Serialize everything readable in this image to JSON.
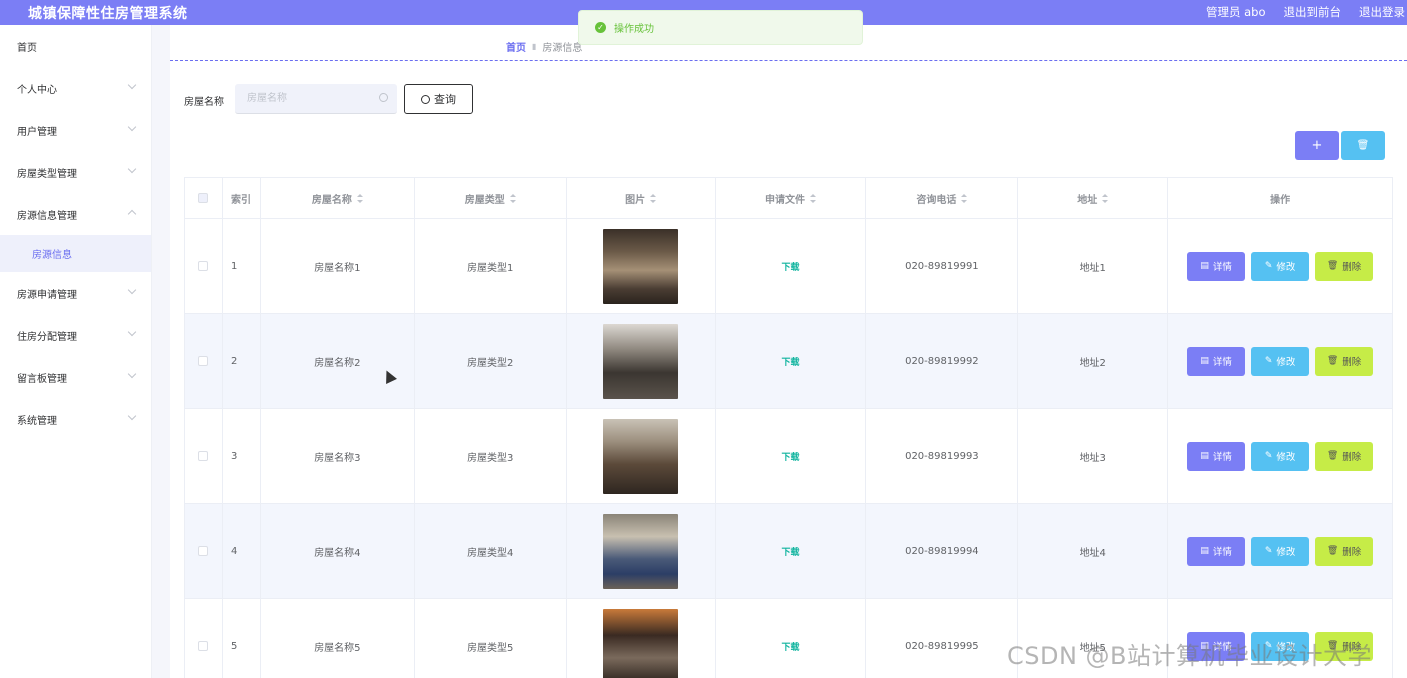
{
  "header": {
    "title": "城镇保障性住房管理系统",
    "user": "管理员 abo",
    "back_label": "退出到前台",
    "logout_label": "退出登录"
  },
  "toast": {
    "text": "操作成功",
    "icon": "check-circle-icon"
  },
  "sidebar": {
    "items": [
      {
        "label": "首页"
      },
      {
        "label": "个人中心"
      },
      {
        "label": "用户管理"
      },
      {
        "label": "房屋类型管理"
      },
      {
        "label": "房源信息管理"
      },
      {
        "label": "房源信息"
      },
      {
        "label": "房源申请管理"
      },
      {
        "label": "住房分配管理"
      },
      {
        "label": "留言板管理"
      },
      {
        "label": "系统管理"
      }
    ]
  },
  "breadcrumb": {
    "home": "首页",
    "current": "房源信息"
  },
  "search": {
    "label": "房屋名称",
    "placeholder": "房屋名称",
    "button": "查询"
  },
  "toolbar": {
    "add": "+",
    "delete": "🗑"
  },
  "table": {
    "headers": [
      "索引",
      "房屋名称",
      "房屋类型",
      "图片",
      "申请文件",
      "咨询电话",
      "地址",
      "操作"
    ],
    "rows": [
      {
        "index": "1",
        "name": "房屋名称1",
        "type": "房屋类型1",
        "file": "下载",
        "phone": "020-89819991",
        "address": "地址1"
      },
      {
        "index": "2",
        "name": "房屋名称2",
        "type": "房屋类型2",
        "file": "下载",
        "phone": "020-89819992",
        "address": "地址2"
      },
      {
        "index": "3",
        "name": "房屋名称3",
        "type": "房屋类型3",
        "file": "下载",
        "phone": "020-89819993",
        "address": "地址3"
      },
      {
        "index": "4",
        "name": "房屋名称4",
        "type": "房屋类型4",
        "file": "下载",
        "phone": "020-89819994",
        "address": "地址4"
      },
      {
        "index": "5",
        "name": "房屋名称5",
        "type": "房屋类型5",
        "file": "下载",
        "phone": "020-89819995",
        "address": "地址5"
      }
    ],
    "actions": {
      "detail": "详情",
      "edit": "修改",
      "delete": "删除"
    }
  },
  "watermark": "CSDN @B站计算机毕业设计大学",
  "colors": {
    "primary": "#7b7ef5",
    "info": "#55c1f2",
    "danger_lime": "#c6ec47",
    "success": "#67c23a",
    "link": "#13b5a0"
  }
}
